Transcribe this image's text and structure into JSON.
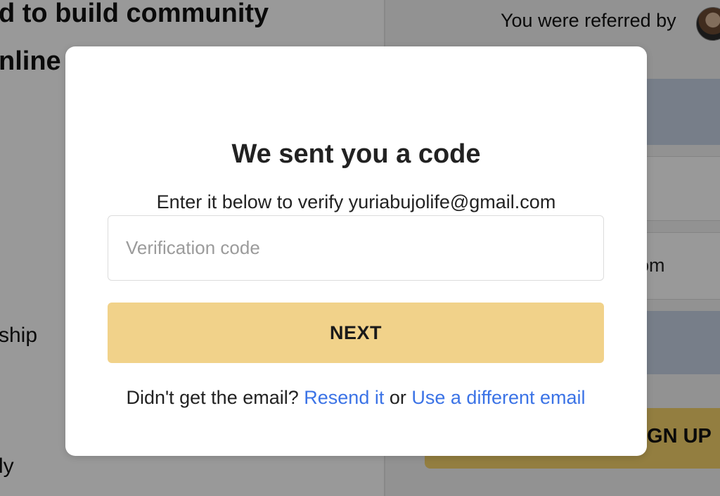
{
  "background": {
    "headline_line1": "d to build community",
    "headline_line2": "nline",
    "side_word1": "ship",
    "side_word2": "ly",
    "referral_text": "You were referred by",
    "field3_text": "om",
    "signup_label": "IGN UP"
  },
  "modal": {
    "title": "We sent you a code",
    "subtitle": "Enter it below to verify yuriabujolife@gmail.com",
    "code_placeholder": "Verification code",
    "code_value": "",
    "next_label": "NEXT",
    "help_prefix": "Didn't get the email?",
    "resend_label": "Resend it",
    "or_text": "or",
    "different_email_label": "Use a different email"
  },
  "colors": {
    "overlay": "rgba(0,0,0,0.40)",
    "next_button": "#f1d28a",
    "link": "#3b73e6",
    "signup_button": "#f6d36b"
  },
  "icons": {
    "referrer_avatar": "avatar"
  }
}
